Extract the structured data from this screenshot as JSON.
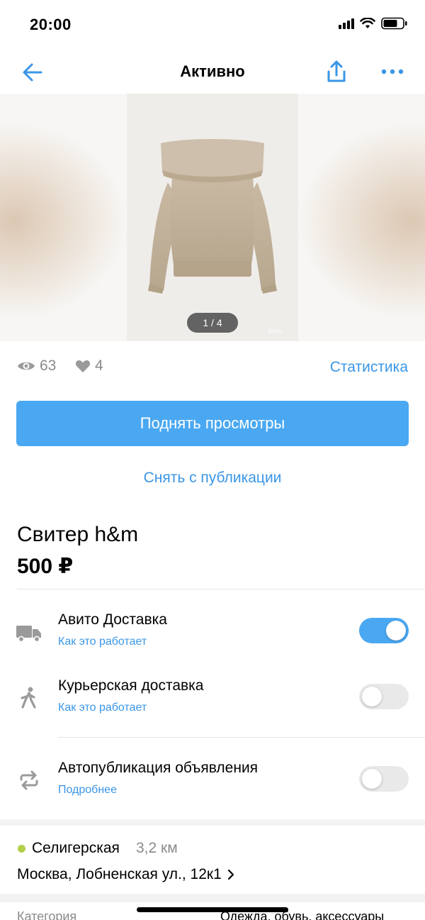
{
  "status_bar": {
    "time": "20:00"
  },
  "nav": {
    "title": "Активно",
    "icons": [
      "back-arrow-icon",
      "share-icon",
      "more-icon"
    ]
  },
  "gallery": {
    "pager": "1 / 4",
    "watermark": "Avito"
  },
  "stats": {
    "views": "63",
    "likes": "4",
    "link": "Статистика"
  },
  "actions": {
    "raise_views": "Поднять просмотры",
    "unpublish": "Снять с публикации"
  },
  "item": {
    "title": "Свитер h&m",
    "price": "500 ₽"
  },
  "options": [
    {
      "label": "Авито Доставка",
      "sub": "Как это работает",
      "enabled": true,
      "icon": "truck-icon"
    },
    {
      "label": "Курьерская доставка",
      "sub": "Как это работает",
      "enabled": false,
      "icon": "courier-icon"
    },
    {
      "label": "Автопубликация объявления",
      "sub": "Подробнее",
      "enabled": false,
      "icon": "repeat-icon"
    }
  ],
  "location": {
    "metro": "Селигерская",
    "distance": "3,2 км",
    "address": "Москва, Лобненская ул., 12к1"
  },
  "details": {
    "key": "Категория",
    "value": "Одежда, обувь, аксессуары"
  },
  "colors": {
    "accent": "#4aa8f2",
    "link": "#3a96e6",
    "metro": "#b2cf4a"
  }
}
